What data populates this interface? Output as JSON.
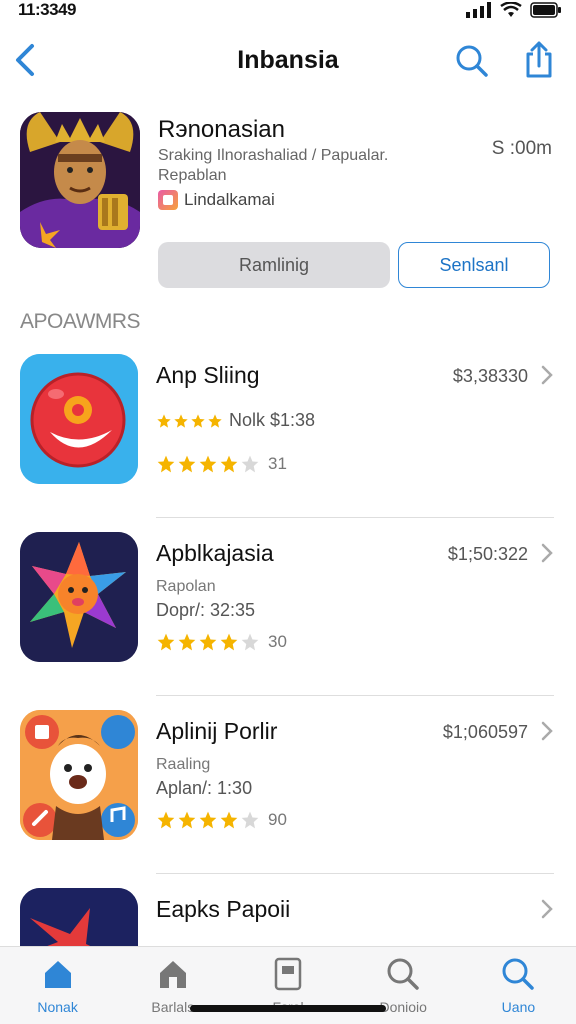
{
  "status": {
    "time": "11:3349"
  },
  "nav": {
    "title": "Inbansia"
  },
  "hero": {
    "name": "Rэnonasian",
    "subtitle": "Sraking Ilnorashaliad / Papualar. Repablan",
    "developer": "Lindalkamai",
    "price": "S :00m",
    "primary_button": "Ramlinig",
    "secondary_button": "Senlsanl"
  },
  "section": {
    "label": "APOAWMRS"
  },
  "apps": [
    {
      "name": "Anp Sliing",
      "price": "$3,38330",
      "line1": "",
      "line2": "Nolk $1:38",
      "rating": 4,
      "count": "31",
      "colors": {
        "bg": "#2fa7e6",
        "accent": "#e8343c"
      }
    },
    {
      "name": "Apblkajasia",
      "price": "$1;50:322",
      "line1": "Rapolan",
      "line2": "Dopr/: 32:35",
      "rating": 4,
      "count": "30",
      "colors": {
        "bg": "#1d1e4a",
        "accent": "#f5a623"
      }
    },
    {
      "name": "Aplinij Porlir",
      "price": "$1;060597",
      "line1": "Raaling",
      "line2": "Aplan/: 1:30",
      "rating": 4,
      "count": "90",
      "colors": {
        "bg": "#f59a3a",
        "accent": "#2f86d6"
      }
    },
    {
      "name": "Eapks Papoii",
      "price": "",
      "line1": "",
      "line2": "",
      "rating": 0,
      "count": "",
      "colors": {
        "bg": "#1a1f5a",
        "accent": "#e33a3a"
      }
    }
  ],
  "tabs": [
    {
      "label": "Nonak",
      "icon": "house-icon",
      "active": true
    },
    {
      "label": "Barlals",
      "icon": "house-gray-icon",
      "active": false
    },
    {
      "label": "Fsrol",
      "icon": "card-icon",
      "active": false
    },
    {
      "label": "Donioio",
      "icon": "search-icon",
      "active": false
    },
    {
      "label": "Uano",
      "icon": "search-blue-icon",
      "active": true
    }
  ],
  "colors": {
    "accent": "#2f86d6",
    "star": "#f5b400",
    "divider": "#dedede"
  }
}
